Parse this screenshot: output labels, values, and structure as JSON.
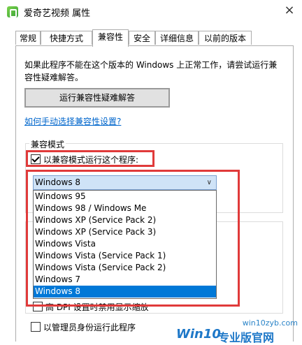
{
  "window": {
    "title": "爱奇艺视频 属性",
    "close_glyph": "×"
  },
  "tabs": [
    {
      "label": "常规"
    },
    {
      "label": "快捷方式"
    },
    {
      "label": "兼容性"
    },
    {
      "label": "安全"
    },
    {
      "label": "详细信息"
    },
    {
      "label": "以前的版本"
    }
  ],
  "intro_text": "如果此程序不能在这个版本的 Windows 上正常工作，请尝试运行兼容性疑难解答。",
  "troubleshoot_button": "运行兼容性疑难解答",
  "manual_link": "如何手动选择兼容性设置?",
  "compat_group": {
    "label": "兼容模式",
    "checkbox_label": "以兼容模式运行这个程序:",
    "checked": true,
    "selected": "Windows 8",
    "chevron": "∨",
    "options": [
      "Windows 95",
      "Windows 98 / Windows Me",
      "Windows XP (Service Pack 2)",
      "Windows XP (Service Pack 3)",
      "Windows Vista",
      "Windows Vista (Service Pack 1)",
      "Windows Vista (Service Pack 2)",
      "Windows 7",
      "Windows 8"
    ]
  },
  "settings": {
    "dpi_label": "高 DPI 设置时禁用显示缩放",
    "admin_label": "以管理员身份运行此程序"
  },
  "watermark": {
    "site": "win10zyb.com",
    "brand": "Win10",
    "brand_cn": "专业版官网"
  },
  "colors": {
    "highlight": "#0078d7",
    "annotation_red": "#e03a3a",
    "link": "#0066cc"
  }
}
